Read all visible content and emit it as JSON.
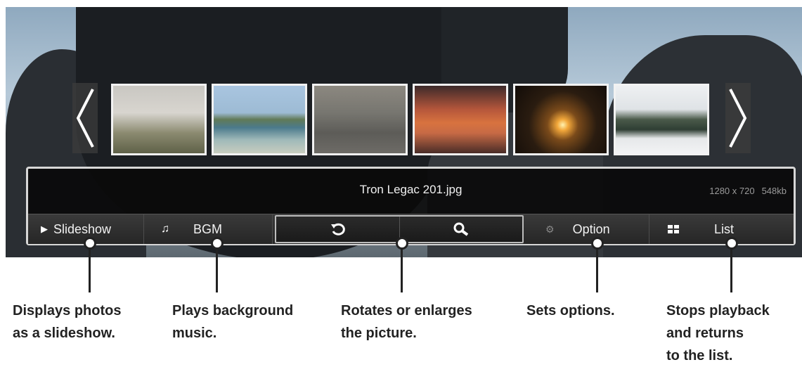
{
  "thumbnails": [
    {
      "name": "cherry-blossom-tree"
    },
    {
      "name": "sea-coast"
    },
    {
      "name": "birds-over-water"
    },
    {
      "name": "orange-sunset-sky"
    },
    {
      "name": "sun-through-clouds"
    },
    {
      "name": "snowy-garden"
    }
  ],
  "navigation": {
    "prev_icon": "chevron-left-icon",
    "next_icon": "chevron-right-icon"
  },
  "info": {
    "filename": "Tron Legac 201.jpg",
    "resolution": "1280 x 720",
    "size": "548kb"
  },
  "controls": {
    "slideshow_icon": "▶",
    "slideshow_label": "Slideshow",
    "bgm_icon": "♫",
    "bgm_label": "BGM",
    "rotate_icon": "rotate-icon",
    "zoom_icon": "magnifier-icon",
    "option_icon": "⚙",
    "option_label": "Option",
    "list_icon": "grid-icon",
    "list_label": "List"
  },
  "captions": {
    "slideshow": [
      "Displays photos",
      "as a slideshow."
    ],
    "bgm": [
      "Plays background",
      "music."
    ],
    "rotate_zoom": [
      "Rotates or enlarges",
      "the picture."
    ],
    "option": [
      "Sets options."
    ],
    "list": [
      "Stops playback",
      "and returns",
      "to the list."
    ]
  },
  "colors": {
    "bar_background": "#0a0a0a",
    "text": "#f0f0f0",
    "meta_text": "#9a9a9a",
    "caption_text": "#222222"
  }
}
